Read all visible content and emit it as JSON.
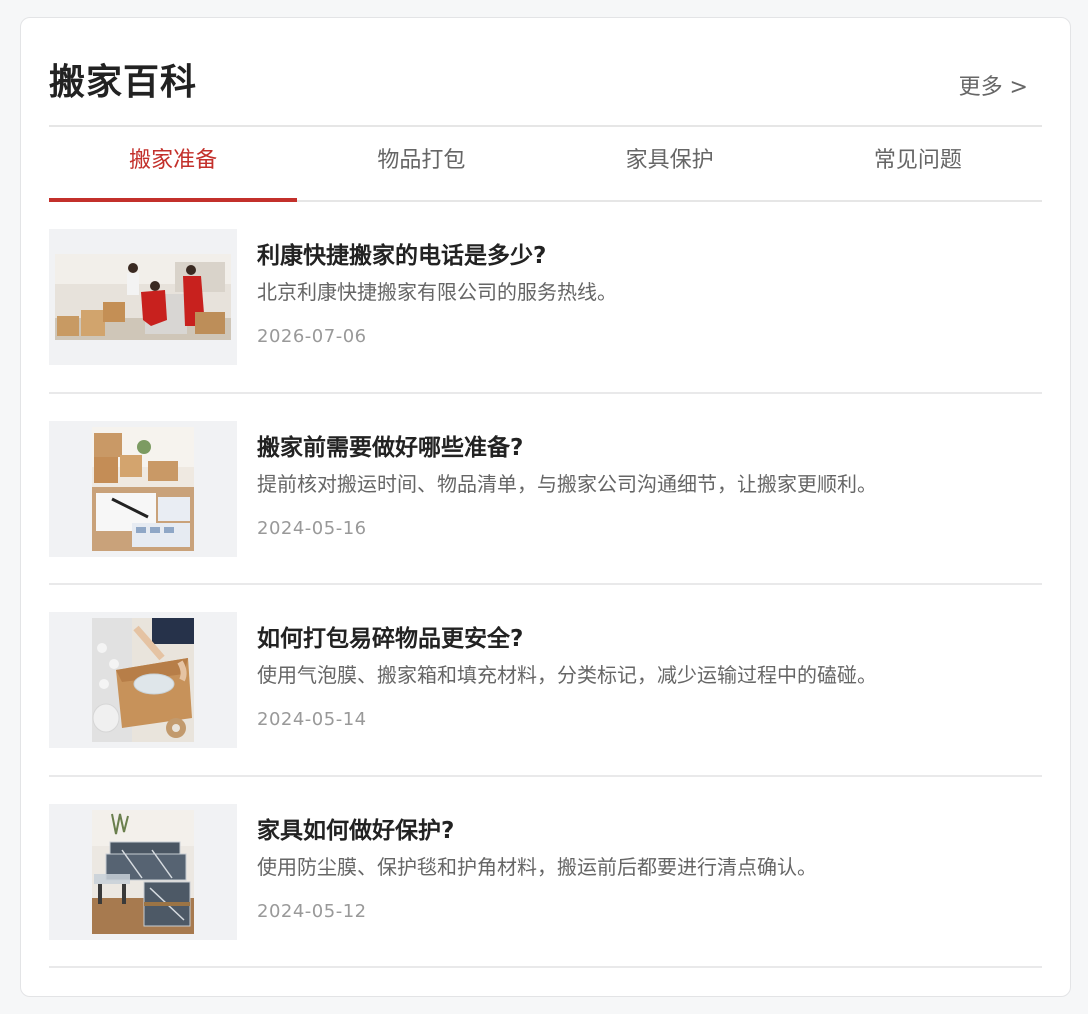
{
  "header": {
    "title": "搬家百科",
    "more": "更多 >"
  },
  "tabs": [
    {
      "label": "搬家准备",
      "active": true
    },
    {
      "label": "物品打包",
      "active": false
    },
    {
      "label": "家具保护",
      "active": false
    },
    {
      "label": "常见问题",
      "active": false
    }
  ],
  "articles": [
    {
      "title": "利康快捷搬家的电话是多少?",
      "desc": "北京利康快捷搬家有限公司的服务热线。",
      "date": "2026-07-06"
    },
    {
      "title": "搬家前需要做好哪些准备?",
      "desc": "提前核对搬运时间、物品清单，与搬家公司沟通细节，让搬家更顺利。",
      "date": "2024-05-16"
    },
    {
      "title": "如何打包易碎物品更安全?",
      "desc": "使用气泡膜、搬家箱和填充材料，分类标记，减少运输过程中的磕碰。",
      "date": "2024-05-14"
    },
    {
      "title": "家具如何做好保护?",
      "desc": "使用防尘膜、保护毯和护角材料，搬运前后都要进行清点确认。",
      "date": "2024-05-12"
    }
  ],
  "colors": {
    "accent": "#c3302b",
    "text": "#222222",
    "muted": "#666666",
    "date": "#999999",
    "divider": "#e6e6e6"
  }
}
